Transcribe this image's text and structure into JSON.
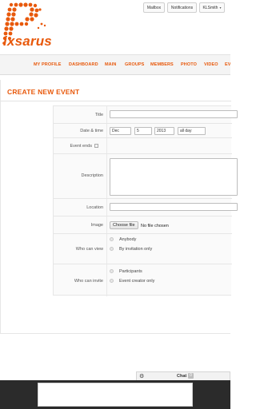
{
  "header": {
    "logo_text": "ixsarus",
    "buttons": [
      {
        "label": "Mailbox"
      },
      {
        "label": "Notifications"
      },
      {
        "label": "KLSmith",
        "caret": "▾"
      }
    ]
  },
  "nav": {
    "items": [
      {
        "label": "MY PROFILE"
      },
      {
        "label": "DASHBOARD"
      },
      {
        "label": "MAIN"
      },
      {
        "label": "GROUPS"
      },
      {
        "label": "MEMBERS"
      },
      {
        "label": "PHOTO"
      },
      {
        "label": "VIDEO"
      },
      {
        "label": "EV"
      }
    ]
  },
  "page": {
    "title": "CREATE NEW EVENT"
  },
  "form": {
    "title_label": "Title",
    "title_value": "",
    "datetime_label": "Date & time",
    "month": "Dec",
    "day": "5",
    "year": "2013",
    "time": "all day",
    "event_ends_label": "Event ends",
    "description_label": "Description",
    "location_label": "Location",
    "image_label": "Image",
    "choose_file_label": "Choose file",
    "no_file_label": "No file chosen",
    "who_can_view_label": "Who can view",
    "view_options": [
      "Anybody",
      "By invitation only"
    ],
    "who_can_invite_label": "Who can invite",
    "invite_options": [
      "Participants",
      "Event creator only"
    ]
  },
  "chat": {
    "gear_icon": "gear-icon",
    "label": "Chat",
    "count": "0"
  },
  "colors": {
    "accent": "#e8590c",
    "footer": "#2b2b2b"
  }
}
